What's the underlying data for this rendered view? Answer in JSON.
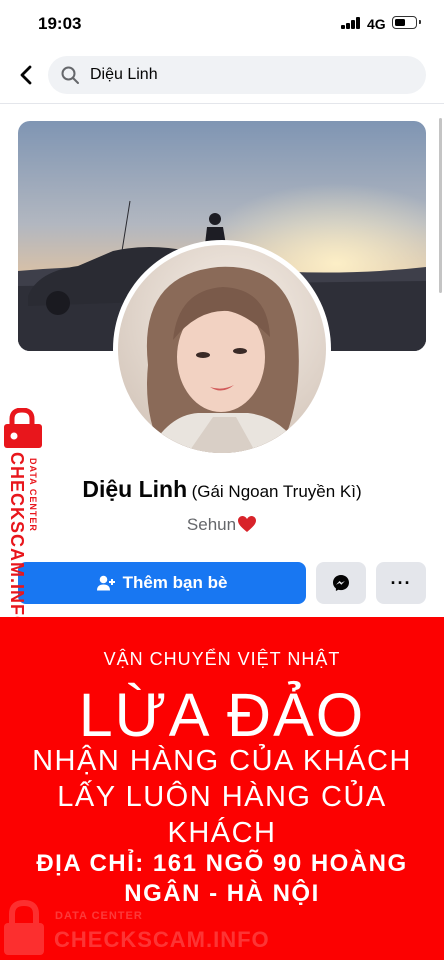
{
  "status_bar": {
    "time": "19:03",
    "network": "4G",
    "battery_level": 0.55,
    "icons": [
      "signal-icon",
      "battery-icon"
    ]
  },
  "search": {
    "value": "Diệu Linh",
    "icon": "search-icon",
    "back_icon": "chevron-left-icon"
  },
  "profile": {
    "name": "Diệu Linh",
    "alternate_name": "(Gái Ngoan Truyền Kì)",
    "bio": "Sehun",
    "bio_icon": "heart-icon"
  },
  "actions": {
    "add_friend_label": "Thêm bạn bè",
    "add_friend_icon": "add-friend-icon",
    "messenger_icon": "messenger-icon",
    "more_label": "···"
  },
  "warning": {
    "company": "VẬN CHUYỂN VIỆT NHẬT",
    "headline": "LỪA ĐẢO",
    "description": "NHẬN HÀNG CỦA KHÁCH LẤY LUÔN HÀNG CỦA KHÁCH",
    "address": "ĐỊA CHỈ: 161 NGÕ 90 HOÀNG NGÂN - HÀ NỘI"
  },
  "watermark": {
    "brand": "CHECKSCAM.INFO",
    "sub": "DATA CENTER"
  },
  "colors": {
    "primary_button": "#1877f2",
    "warning_red": "#fc0101",
    "watermark_red": "#e8161c",
    "secondary_button": "#e4e6eb"
  }
}
